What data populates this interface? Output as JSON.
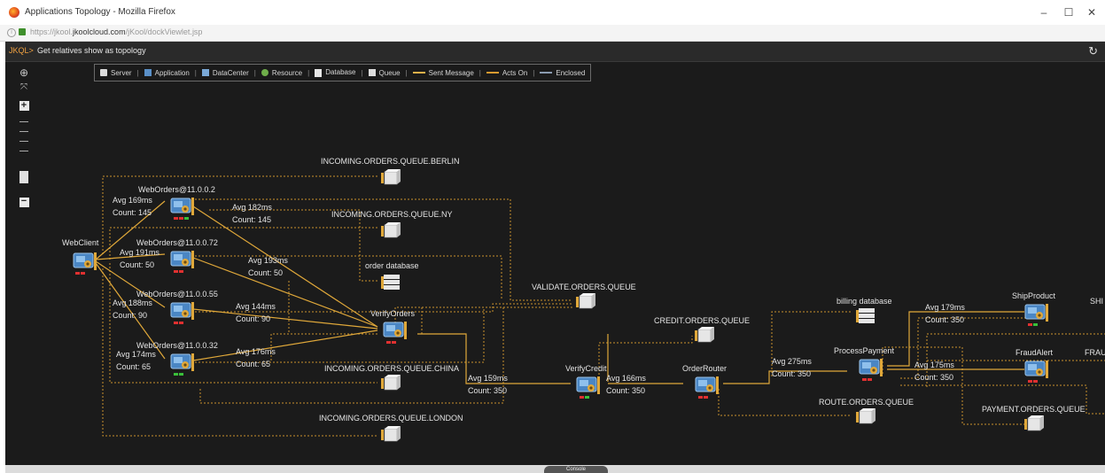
{
  "window": {
    "title": "Applications Topology - Mozilla Firefox",
    "url_prefix": "https://jkool.",
    "url_domain": "jkoolcloud.com",
    "url_path": "/jKool/dockViewlet.jsp",
    "buttons": [
      "–",
      "☐",
      "✕"
    ]
  },
  "query": {
    "prompt": "JKQL>",
    "text": "Get relatives show as topology"
  },
  "legend": {
    "items": [
      {
        "label": "Server",
        "icon": "server-icon"
      },
      {
        "label": "Application",
        "icon": "application-icon"
      },
      {
        "label": "DataCenter",
        "icon": "datacenter-icon"
      },
      {
        "label": "Resource",
        "icon": "resource-icon"
      },
      {
        "label": "Database",
        "icon": "database-icon"
      },
      {
        "label": "Queue",
        "icon": "queue-icon"
      },
      {
        "label": "Sent Message",
        "icon": "sent-message-line",
        "color": "#e0b04a"
      },
      {
        "label": "Acts On",
        "icon": "acts-on-line",
        "color": "#d89a30"
      },
      {
        "label": "Enclosed",
        "icon": "enclosed-line",
        "color": "#8a9bb0"
      }
    ]
  },
  "colors": {
    "edge": "#e0a83a",
    "edge_dotted": "#c8922e",
    "label": "#e4e4e4",
    "node_blue": "#4a86c4"
  },
  "nodes": [
    {
      "id": "webclient",
      "label": "WebClient",
      "type": "application",
      "health": [
        "#e03030",
        "#e03030"
      ]
    },
    {
      "id": "wo1",
      "label": "WebOrders@11.0.0.2",
      "type": "application",
      "health": [
        "#e03030",
        "#e03030",
        "#3ac03a"
      ]
    },
    {
      "id": "wo2",
      "label": "WebOrders@11.0.0.72",
      "type": "application",
      "health": [
        "#e03030",
        "#e03030"
      ]
    },
    {
      "id": "wo3",
      "label": "WebOrders@11.0.0.55",
      "type": "application",
      "health": [
        "#e03030",
        "#e03030"
      ]
    },
    {
      "id": "wo4",
      "label": "WebOrders@11.0.0.32",
      "type": "application",
      "health": [
        "#3ac03a",
        "#3ac03a"
      ]
    },
    {
      "id": "q_berlin",
      "label": "INCOMING.ORDERS.QUEUE.BERLIN",
      "type": "queue"
    },
    {
      "id": "q_ny",
      "label": "INCOMING.ORDERS.QUEUE.NY",
      "type": "queue"
    },
    {
      "id": "orderdb",
      "label": "order database",
      "type": "database"
    },
    {
      "id": "verifyorders",
      "label": "VerifyOrders",
      "type": "application",
      "health": [
        "#e03030",
        "#e03030"
      ]
    },
    {
      "id": "q_china",
      "label": "INCOMING.ORDERS.QUEUE.CHINA",
      "type": "queue"
    },
    {
      "id": "q_london",
      "label": "INCOMING.ORDERS.QUEUE.LONDON",
      "type": "queue"
    },
    {
      "id": "q_validate",
      "label": "VALIDATE.ORDERS.QUEUE",
      "type": "queue"
    },
    {
      "id": "verifycredit",
      "label": "VerifyCredit",
      "type": "application",
      "health": [
        "#e03030",
        "#3ac03a"
      ]
    },
    {
      "id": "q_credit",
      "label": "CREDIT.ORDERS.QUEUE",
      "type": "queue"
    },
    {
      "id": "orderrouter",
      "label": "OrderRouter",
      "type": "application",
      "health": [
        "#e03030",
        "#e03030"
      ]
    },
    {
      "id": "billingdb",
      "label": "billing database",
      "type": "database"
    },
    {
      "id": "processpayment",
      "label": "ProcessPayment",
      "type": "application",
      "health": [
        "#e03030",
        "#e03030"
      ]
    },
    {
      "id": "q_route",
      "label": "ROUTE.ORDERS.QUEUE",
      "type": "queue"
    },
    {
      "id": "shipproduct",
      "label": "ShipProduct",
      "type": "application",
      "health": [
        "#e03030",
        "#3ac03a"
      ]
    },
    {
      "id": "fraudalert",
      "label": "FraudAlert",
      "type": "application",
      "health": [
        "#e03030",
        "#e03030"
      ]
    },
    {
      "id": "q_payment",
      "label": "PAYMENT.ORDERS.QUEUE",
      "type": "queue"
    },
    {
      "id": "shi_cut",
      "label": "SHI",
      "type": "text"
    },
    {
      "id": "frau_cut",
      "label": "FRAU",
      "type": "text"
    }
  ],
  "edge_labels": [
    {
      "id": "e1",
      "avg": "Avg 169ms",
      "count": "Count: 145"
    },
    {
      "id": "e2",
      "avg": "Avg 182ms",
      "count": "Count: 145"
    },
    {
      "id": "e3",
      "avg": "Avg 191ms",
      "count": "Count: 50"
    },
    {
      "id": "e4",
      "avg": "Avg 193ms",
      "count": "Count: 50"
    },
    {
      "id": "e5",
      "avg": "Avg 188ms",
      "count": "Count: 90"
    },
    {
      "id": "e6",
      "avg": "Avg 144ms",
      "count": "Count: 90"
    },
    {
      "id": "e7",
      "avg": "Avg 174ms",
      "count": "Count: 65"
    },
    {
      "id": "e8",
      "avg": "Avg 176ms",
      "count": "Count: 65"
    },
    {
      "id": "e9",
      "avg": "Avg 159ms",
      "count": "Count: 350"
    },
    {
      "id": "e10",
      "avg": "Avg 166ms",
      "count": "Count: 350"
    },
    {
      "id": "e11",
      "avg": "Avg 275ms",
      "count": "Count: 350"
    },
    {
      "id": "e12",
      "avg": "Avg 179ms",
      "count": "Count: 350"
    },
    {
      "id": "e13",
      "avg": "Avg 175ms",
      "count": "Count: 350"
    }
  ],
  "console_tab": "Console"
}
